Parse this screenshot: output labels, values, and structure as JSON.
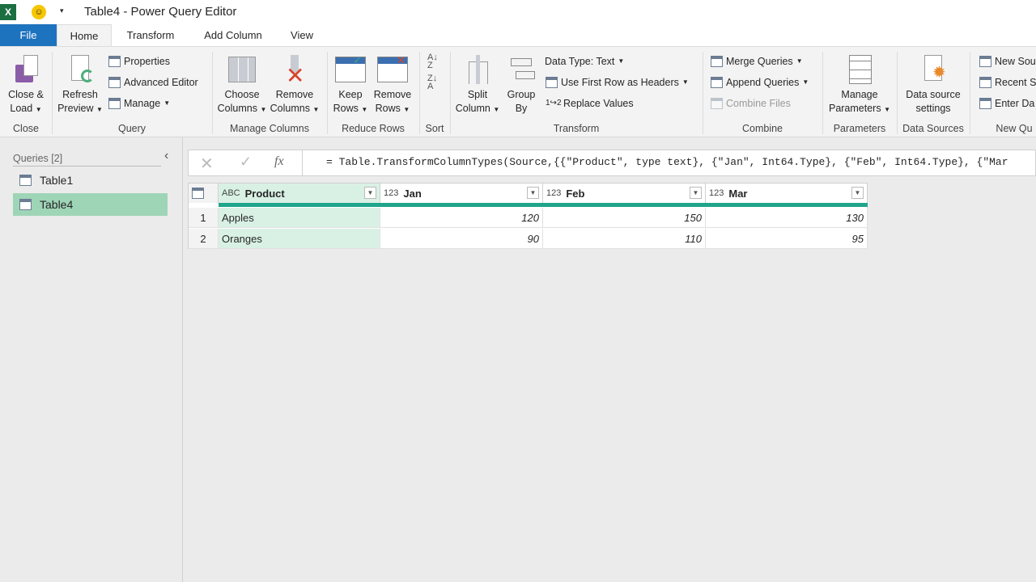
{
  "title": "Table4 - Power Query Editor",
  "tabs": [
    "File",
    "Home",
    "Transform",
    "Add Column",
    "View"
  ],
  "ribbon": {
    "close_load": [
      "Close &",
      "Load"
    ],
    "refresh": [
      "Refresh",
      "Preview"
    ],
    "properties": "Properties",
    "advanced_editor": "Advanced Editor",
    "manage": "Manage",
    "choose_columns": [
      "Choose",
      "Columns"
    ],
    "remove_columns": [
      "Remove",
      "Columns"
    ],
    "keep_rows": [
      "Keep",
      "Rows"
    ],
    "remove_rows": [
      "Remove",
      "Rows"
    ],
    "split_column": [
      "Split",
      "Column"
    ],
    "group_by": [
      "Group",
      "By"
    ],
    "data_type": "Data Type: Text",
    "first_row": "Use First Row as Headers",
    "replace_values": "Replace Values",
    "merge": "Merge Queries",
    "append": "Append Queries",
    "combine_files": "Combine Files",
    "manage_params": [
      "Manage",
      "Parameters"
    ],
    "ds_settings": [
      "Data source",
      "settings"
    ],
    "new_source": "New Sou",
    "recent": "Recent S",
    "enter_data": "Enter Da",
    "groups": [
      "Close",
      "Query",
      "Manage Columns",
      "Reduce Rows",
      "Sort",
      "Transform",
      "Combine",
      "Parameters",
      "Data Sources",
      "New Qu"
    ]
  },
  "queries": {
    "header": "Queries [2]",
    "items": [
      "Table1",
      "Table4"
    ]
  },
  "formula": "= Table.TransformColumnTypes(Source,{{\"Product\", type text}, {\"Jan\", Int64.Type}, {\"Feb\", Int64.Type}, {\"Mar",
  "grid": {
    "types": [
      "ABC",
      "123",
      "123",
      "123"
    ],
    "columns": [
      "Product",
      "Jan",
      "Feb",
      "Mar"
    ],
    "rows": [
      [
        "1",
        "Apples",
        "120",
        "150",
        "130"
      ],
      [
        "2",
        "Oranges",
        "90",
        "110",
        "95"
      ]
    ]
  },
  "colors": {
    "accent": "#217346",
    "file_tab": "#1e73be",
    "selected": "#9fd5b7",
    "teal": "#1fa58b"
  }
}
